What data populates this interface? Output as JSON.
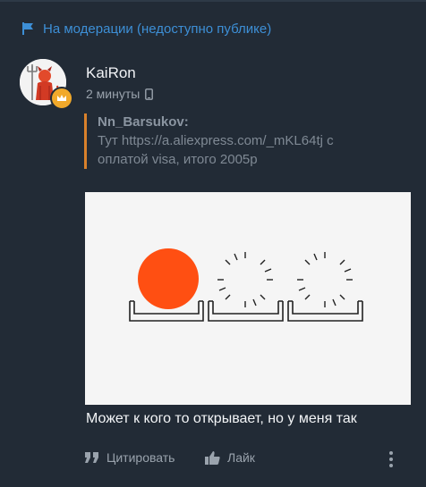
{
  "moderation": {
    "status": "На модерации (недоступно публике)"
  },
  "post": {
    "author": "KaiRon",
    "time": "2 минуты",
    "device_icon": "phone-icon",
    "quote": {
      "author": "Nn_Barsukov:",
      "text": "Тут https://a.aliexpress.com/_mKL64tj с оплатой  visa, итого 2005р"
    },
    "image_icon": "loading-dots-image",
    "message": "Может к кого то открывает, но у меня так"
  },
  "actions": {
    "quote_label": "Цитировать",
    "like_label": "Лайк",
    "more_icon": "more-vertical-icon"
  },
  "colors": {
    "background": "#222b36",
    "link_blue": "#3d8fd6",
    "quote_bar": "#d9812b",
    "badge": "#f1a92b",
    "loader_dot": "#ff4f12"
  }
}
